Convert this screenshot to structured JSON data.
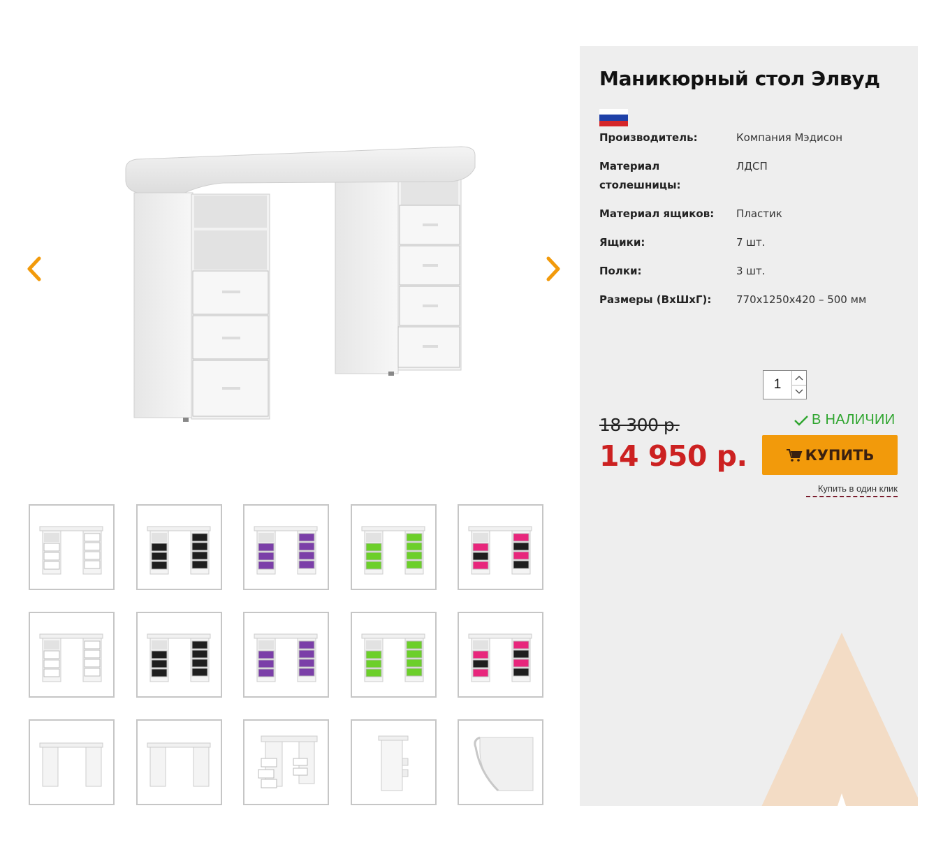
{
  "product": {
    "title": "Маникюрный стол Элвуд",
    "country_flag": "russia-flag-icon"
  },
  "specs": [
    {
      "label": "Производитель:",
      "value": "Компания Мэдисон"
    },
    {
      "label": "Материал столешницы:",
      "value": "ЛДСП"
    },
    {
      "label": "Материал ящиков:",
      "value": "Пластик"
    },
    {
      "label": "Ящики:",
      "value": "7 шт."
    },
    {
      "label": "Полки:",
      "value": "3 шт."
    },
    {
      "label": "Размеры (ВхШхГ):",
      "value": "770х1250х420 – 500 мм"
    }
  ],
  "purchase": {
    "quantity": "1",
    "old_price": "18 300 р.",
    "new_price": "14 950 р.",
    "stock_status": "В НАЛИЧИИ",
    "buy_label": "КУПИТЬ",
    "one_click_label": "Купить в один клик"
  },
  "gallery": {
    "prev_icon": "chevron-left-icon",
    "next_icon": "chevron-right-icon",
    "thumbnails": [
      {
        "variant": "white",
        "drawer_color": "#ffffff"
      },
      {
        "variant": "black",
        "drawer_color": "#1e1e1e"
      },
      {
        "variant": "purple",
        "drawer_color": "#7b3fa8"
      },
      {
        "variant": "green",
        "drawer_color": "#6ccf2a"
      },
      {
        "variant": "pink-black",
        "drawer_color": "#e8267c"
      },
      {
        "variant": "white-front",
        "drawer_color": "#ffffff"
      },
      {
        "variant": "black-front",
        "drawer_color": "#1e1e1e"
      },
      {
        "variant": "purple-front",
        "drawer_color": "#7b3fa8"
      },
      {
        "variant": "green-front",
        "drawer_color": "#6ccf2a"
      },
      {
        "variant": "pink-black-front",
        "drawer_color": "#e8267c"
      },
      {
        "variant": "back",
        "drawer_color": "#ffffff"
      },
      {
        "variant": "back-angle",
        "drawer_color": "#ffffff"
      },
      {
        "variant": "drawers-open",
        "drawer_color": "#ffffff"
      },
      {
        "variant": "side",
        "drawer_color": "#ffffff"
      },
      {
        "variant": "top-detail",
        "drawer_color": "#ffffff"
      }
    ]
  },
  "colors": {
    "accent": "#f29a0b",
    "price_red": "#cc2121",
    "stock_green": "#2fa52f",
    "panel_bg": "#eeeeee"
  }
}
